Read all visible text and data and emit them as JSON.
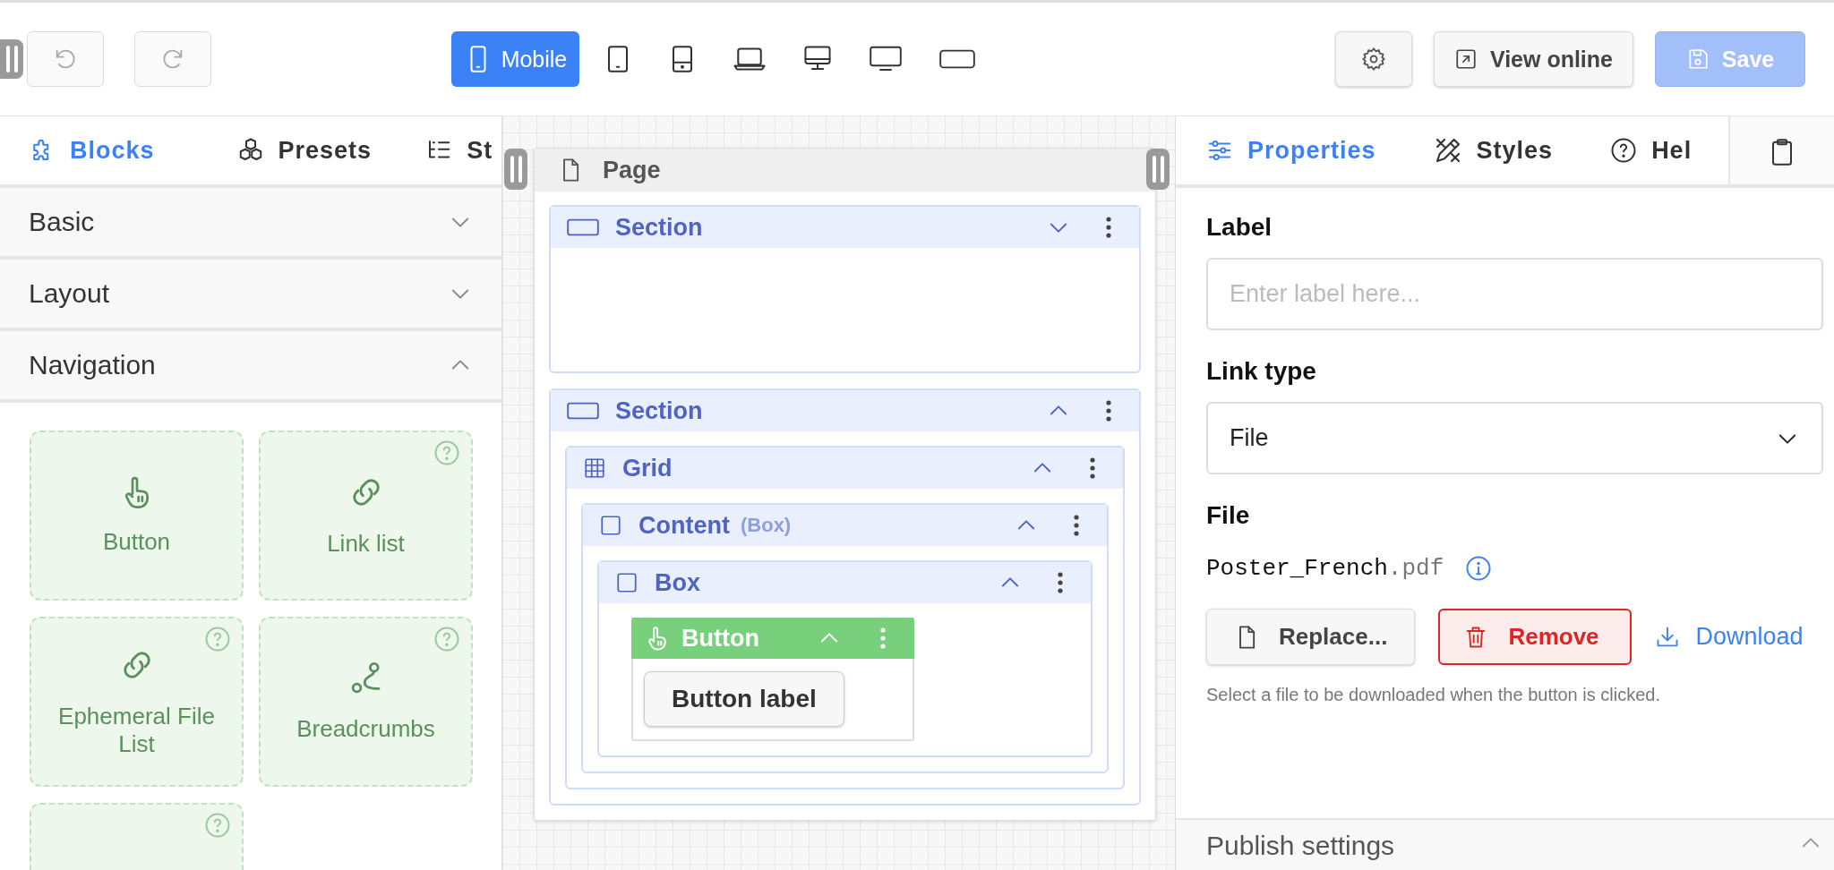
{
  "toolbar": {
    "undo": {
      "disabled": true
    },
    "redo": {
      "disabled": true
    },
    "devices": [
      {
        "label": "Mobile",
        "selected": true
      },
      {
        "selected": false
      },
      {
        "selected": false
      },
      {
        "selected": false
      },
      {
        "selected": false
      },
      {
        "selected": false
      },
      {
        "selected": false
      }
    ],
    "view_online": "View online",
    "save": {
      "label": "Save",
      "disabled": true
    }
  },
  "blocks_panel": {
    "tabs": [
      {
        "label": "Blocks",
        "selected": true
      },
      {
        "label": "Presets",
        "selected": false
      },
      {
        "label": "St",
        "selected": false
      }
    ],
    "groups": [
      {
        "label": "Basic",
        "expanded": false
      },
      {
        "label": "Layout",
        "expanded": false
      },
      {
        "label": "Navigation",
        "expanded": true,
        "items": [
          {
            "label": "Button",
            "kind": "pointer",
            "help": false
          },
          {
            "label": "Link list",
            "kind": "link",
            "help": true
          },
          {
            "label": "Ephemeral File List",
            "kind": "link",
            "help": true
          },
          {
            "label": "Breadcrumbs",
            "kind": "route",
            "help": true
          },
          {
            "kind": "cut",
            "help": true
          }
        ]
      }
    ]
  },
  "canvas": {
    "page": {
      "label": "Page",
      "children": [
        {
          "kind": "section",
          "label": "Section",
          "expanded": false
        },
        {
          "kind": "section",
          "label": "Section",
          "expanded": true,
          "children": [
            {
              "kind": "grid",
              "label": "Grid",
              "expanded": true,
              "children": [
                {
                  "kind": "box",
                  "label": "Content",
                  "sublabel": "(Box)",
                  "expanded": true,
                  "children": [
                    {
                      "kind": "box",
                      "label": "Box",
                      "expanded": true,
                      "children": [
                        {
                          "kind": "button",
                          "label": "Button",
                          "expanded": true,
                          "button_label": "Button label"
                        }
                      ]
                    }
                  ]
                }
              ]
            }
          ]
        }
      ]
    }
  },
  "properties_panel": {
    "tabs": [
      {
        "label": "Properties",
        "selected": true
      },
      {
        "label": "Styles",
        "selected": false
      },
      {
        "label": "Hel",
        "selected": false
      }
    ],
    "label_field": {
      "heading": "Label",
      "placeholder": "Enter label here..."
    },
    "link_type": {
      "heading": "Link type",
      "value": "File"
    },
    "file": {
      "heading": "File",
      "name": "Poster_French",
      "extension": ".pdf",
      "replace": "Replace...",
      "remove": "Remove",
      "download": "Download",
      "hint": "Select a file to be downloaded when the button is clicked."
    },
    "publish_settings": {
      "label": "Publish settings",
      "expanded": true
    }
  }
}
